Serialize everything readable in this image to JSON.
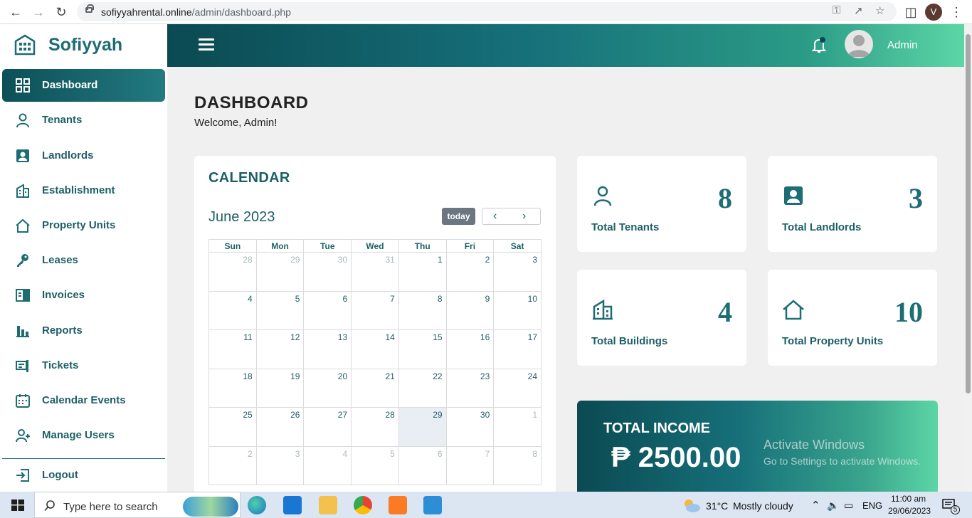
{
  "browser": {
    "url_host": "sofiyyahrental.online",
    "url_path": "/admin/dashboard.php",
    "profile_initial": "V"
  },
  "brand": {
    "name": "Sofiyyah"
  },
  "sidebar": {
    "items": [
      {
        "label": "Dashboard",
        "icon": "dashboard-grid-icon"
      },
      {
        "label": "Tenants",
        "icon": "person-icon"
      },
      {
        "label": "Landlords",
        "icon": "contact-card-icon"
      },
      {
        "label": "Establishment",
        "icon": "building-icon"
      },
      {
        "label": "Property Units",
        "icon": "house-icon"
      },
      {
        "label": "Leases",
        "icon": "key-icon"
      },
      {
        "label": "Invoices",
        "icon": "invoice-icon"
      },
      {
        "label": "Reports",
        "icon": "bar-chart-icon"
      },
      {
        "label": "Tickets",
        "icon": "ticket-icon"
      },
      {
        "label": "Calendar Events",
        "icon": "calendar-icon"
      },
      {
        "label": "Manage Users",
        "icon": "add-user-icon"
      }
    ],
    "logout": "Logout"
  },
  "header": {
    "user": "Admin"
  },
  "page": {
    "title": "DASHBOARD",
    "welcome": "Welcome, Admin!"
  },
  "calendar": {
    "title": "CALENDAR",
    "month": "June 2023",
    "today_label": "today",
    "prev": "‹",
    "next": "›",
    "weekdays": [
      "Sun",
      "Mon",
      "Tue",
      "Wed",
      "Thu",
      "Fri",
      "Sat"
    ],
    "weeks": [
      [
        "28",
        "29",
        "30",
        "31",
        "1",
        "2",
        "3"
      ],
      [
        "4",
        "5",
        "6",
        "7",
        "8",
        "9",
        "10"
      ],
      [
        "11",
        "12",
        "13",
        "14",
        "15",
        "16",
        "17"
      ],
      [
        "18",
        "19",
        "20",
        "21",
        "22",
        "23",
        "24"
      ],
      [
        "25",
        "26",
        "27",
        "28",
        "29",
        "30",
        "1"
      ],
      [
        "2",
        "3",
        "4",
        "5",
        "6",
        "7",
        "8"
      ]
    ]
  },
  "stats": [
    {
      "label": "Total Tenants",
      "value": "8"
    },
    {
      "label": "Total Landlords",
      "value": "3"
    },
    {
      "label": "Total Buildings",
      "value": "4"
    },
    {
      "label": "Total Property Units",
      "value": "10"
    }
  ],
  "income": {
    "title": "TOTAL INCOME",
    "value": "₱ 2500.00"
  },
  "watermark": {
    "line1": "Activate Windows",
    "line2": "Go to Settings to activate Windows."
  },
  "taskbar": {
    "search_placeholder": "Type here to search",
    "weather_temp": "31°C",
    "weather_text": "Mostly cloudy",
    "language": "ENG",
    "time": "11:00 am",
    "date": "29/06/2023",
    "notification_count": "5"
  },
  "colors": {
    "primary": "#1e6c74",
    "accent_light": "#5cd6a6",
    "dark": "#0b4a52"
  }
}
